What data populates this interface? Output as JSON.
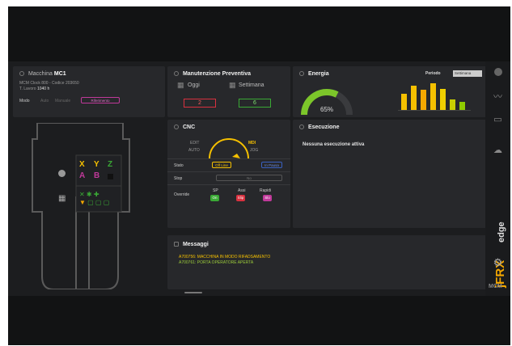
{
  "machine": {
    "title_prefix": "Macchina",
    "title_name": "MC1",
    "line1": "MCM Clock 800 - Codice 203650",
    "line2_label": "T. Lavoro",
    "line2_value": "1040 h",
    "mode_label": "Modo",
    "modes": [
      "Auto",
      "Manuale",
      "Riferimento"
    ],
    "active_mode": "Riferimento",
    "axes": [
      "X",
      "Y",
      "Z",
      "A",
      "B"
    ]
  },
  "maintenance": {
    "title": "Manutenzione Preventiva",
    "today_label": "Oggi",
    "today_value": "2",
    "week_label": "Settimana",
    "week_value": "6"
  },
  "energy": {
    "title": "Energia",
    "period_label": "Periodo",
    "period_value": "Settimana",
    "gauge_value": "65%",
    "gauge_fraction": 0.65,
    "bar_values": [
      0.6,
      0.9,
      0.75,
      1.0,
      0.8,
      0.4,
      0.3
    ],
    "bar_colors": [
      "#f5c000",
      "#f5c000",
      "#f5a800",
      "#f5c000",
      "#f0d000",
      "#c9d000",
      "#8fcc00"
    ]
  },
  "cnc": {
    "title": "CNC",
    "gauge_left_top": "EDIT",
    "gauge_left_bottom": "AUTO",
    "gauge_right_top": "MDI",
    "gauge_right_bottom": "JOG",
    "state_label": "Stato",
    "state_value": "Off Line",
    "state_alt": "In Pausa",
    "stop_label": "Stop",
    "stop_value": "No",
    "override_label": "Override",
    "overrides": [
      {
        "label": "SP",
        "badge": "On",
        "color": "#3aa935"
      },
      {
        "label": "Assi",
        "badge": "Slip",
        "color": "#d8313f"
      },
      {
        "label": "Rapidi",
        "badge": "Slo",
        "color": "#c0399a"
      }
    ]
  },
  "execution": {
    "title": "Esecuzione",
    "message": "Nessuna esecuzione attiva"
  },
  "messages": {
    "title": "Messaggi",
    "lines": [
      "A700756: MACCHINA IN MODO RIFADSAMENTO",
      "A700761: PORTA OPERATORE APERTA"
    ]
  },
  "sidebar": {
    "brand": "jFRX",
    "brand_sub": "edge",
    "footer": "MCM"
  },
  "colors": {
    "accent_yellow": "#f5c000",
    "accent_magenta": "#c0399a",
    "green_msg": "#9ccc3a"
  }
}
